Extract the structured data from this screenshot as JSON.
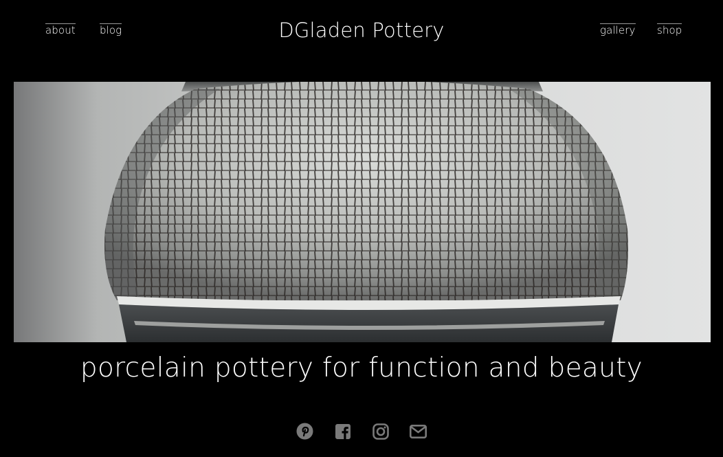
{
  "header": {
    "title": "DGladen Pottery",
    "nav_left": [
      {
        "label": "about"
      },
      {
        "label": "blog"
      }
    ],
    "nav_right": [
      {
        "label": "gallery"
      },
      {
        "label": "shop"
      }
    ]
  },
  "hero": {
    "image_subject": "crackle-glaze-porcelain-pot"
  },
  "tagline": "porcelain pottery for function and beauty",
  "social": {
    "icons": [
      "pinterest-icon",
      "facebook-icon",
      "instagram-icon",
      "email-icon"
    ],
    "icon_color": "#7a7a7a"
  },
  "colors": {
    "background": "#000000",
    "text": "#ffffff"
  }
}
